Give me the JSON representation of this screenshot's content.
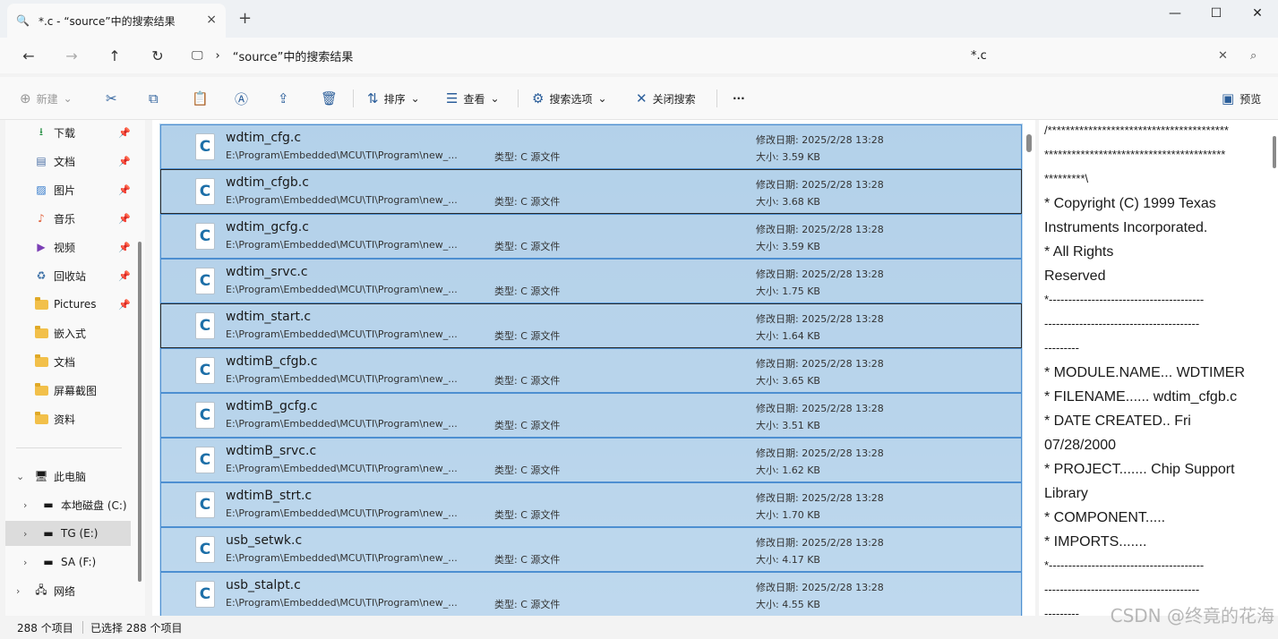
{
  "tab": {
    "title": "*.c - “source”中的搜索结果",
    "close_icon": "×"
  },
  "window": {
    "minimize": "—",
    "maximize": "☐",
    "close": "✕"
  },
  "address": {
    "breadcrumb": "“source”中的搜索结果",
    "search_value": "*.c"
  },
  "toolbar": {
    "new_label": "新建",
    "sort_label": "排序",
    "view_label": "查看",
    "search_options_label": "搜索选项",
    "close_search_label": "关闭搜索",
    "more_label": "···",
    "preview_label": "预览"
  },
  "sidebar": {
    "quick": [
      {
        "label": "下载",
        "icon": "download-icon",
        "pinned": true
      },
      {
        "label": "文档",
        "icon": "document-icon",
        "pinned": true
      },
      {
        "label": "图片",
        "icon": "picture-icon",
        "pinned": true
      },
      {
        "label": "音乐",
        "icon": "music-icon",
        "pinned": true
      },
      {
        "label": "视频",
        "icon": "video-icon",
        "pinned": true
      },
      {
        "label": "回收站",
        "icon": "recycle-bin-icon",
        "pinned": true
      },
      {
        "label": "Pictures",
        "icon": "folder-icon",
        "pinned": true
      },
      {
        "label": "嵌入式",
        "icon": "folder-icon",
        "pinned": false
      },
      {
        "label": "文档",
        "icon": "folder-icon",
        "pinned": false
      },
      {
        "label": "屏幕截图",
        "icon": "folder-icon",
        "pinned": false
      },
      {
        "label": "资料",
        "icon": "folder-icon",
        "pinned": false
      }
    ],
    "this_pc": "此电脑",
    "drives": [
      {
        "label": "本地磁盘 (C:)"
      },
      {
        "label": "TG (E:)",
        "selected": true
      },
      {
        "label": "SA (F:)"
      }
    ],
    "network": "网络"
  },
  "files": [
    {
      "name": "wdtim_cfg.c",
      "path": "E:\\Program\\Embedded\\MCU\\TI\\Program\\new_...",
      "type": "类型: C 源文件",
      "date": "修改日期: 2025/2/28 13:28",
      "size": "大小: 3.59 KB"
    },
    {
      "name": "wdtim_cfgb.c",
      "path": "E:\\Program\\Embedded\\MCU\\TI\\Program\\new_...",
      "type": "类型: C 源文件",
      "date": "修改日期: 2025/2/28 13:28",
      "size": "大小: 3.68 KB",
      "focus": true
    },
    {
      "name": "wdtim_gcfg.c",
      "path": "E:\\Program\\Embedded\\MCU\\TI\\Program\\new_...",
      "type": "类型: C 源文件",
      "date": "修改日期: 2025/2/28 13:28",
      "size": "大小: 3.59 KB"
    },
    {
      "name": "wdtim_srvc.c",
      "path": "E:\\Program\\Embedded\\MCU\\TI\\Program\\new_...",
      "type": "类型: C 源文件",
      "date": "修改日期: 2025/2/28 13:28",
      "size": "大小: 1.75 KB"
    },
    {
      "name": "wdtim_start.c",
      "path": "E:\\Program\\Embedded\\MCU\\TI\\Program\\new_...",
      "type": "类型: C 源文件",
      "date": "修改日期: 2025/2/28 13:28",
      "size": "大小: 1.64 KB",
      "focus": true
    },
    {
      "name": "wdtimB_cfgb.c",
      "path": "E:\\Program\\Embedded\\MCU\\TI\\Program\\new_...",
      "type": "类型: C 源文件",
      "date": "修改日期: 2025/2/28 13:28",
      "size": "大小: 3.65 KB"
    },
    {
      "name": "wdtimB_gcfg.c",
      "path": "E:\\Program\\Embedded\\MCU\\TI\\Program\\new_...",
      "type": "类型: C 源文件",
      "date": "修改日期: 2025/2/28 13:28",
      "size": "大小: 3.51 KB"
    },
    {
      "name": "wdtimB_srvc.c",
      "path": "E:\\Program\\Embedded\\MCU\\TI\\Program\\new_...",
      "type": "类型: C 源文件",
      "date": "修改日期: 2025/2/28 13:28",
      "size": "大小: 1.62 KB"
    },
    {
      "name": "wdtimB_strt.c",
      "path": "E:\\Program\\Embedded\\MCU\\TI\\Program\\new_...",
      "type": "类型: C 源文件",
      "date": "修改日期: 2025/2/28 13:28",
      "size": "大小: 1.70 KB"
    },
    {
      "name": "usb_setwk.c",
      "path": "E:\\Program\\Embedded\\MCU\\TI\\Program\\new_...",
      "type": "类型: C 源文件",
      "date": "修改日期: 2025/2/28 13:28",
      "size": "大小: 4.17 KB"
    },
    {
      "name": "usb_stalpt.c",
      "path": "E:\\Program\\Embedded\\MCU\\TI\\Program\\new_...",
      "type": "类型: C 源文件",
      "date": "修改日期: 2025/2/28 13:28",
      "size": "大小: 4.55 KB"
    }
  ],
  "preview_lines": [
    "/****************************************",
    "****************************************",
    "*********\\",
    "*          Copyright (C) 1999 Texas",
    "Instruments Incorporated.",
    "*                          All Rights",
    "Reserved",
    "*----------------------------------------",
    "----------------------------------------",
    "---------",
    "* MODULE.NAME... WDTIMER",
    "* FILENAME...... wdtim_cfgb.c",
    "* DATE CREATED.. Fri",
    "07/28/2000",
    "* PROJECT....... Chip Support",
    "Library",
    "* COMPONENT.....",
    "* IMPORTS.......",
    "*----------------------------------------",
    "----------------------------------------",
    "---------"
  ],
  "status": {
    "count": "288 个项目",
    "selected": "已选择 288 个项目"
  },
  "watermark": "CSDN @终竟的花海"
}
